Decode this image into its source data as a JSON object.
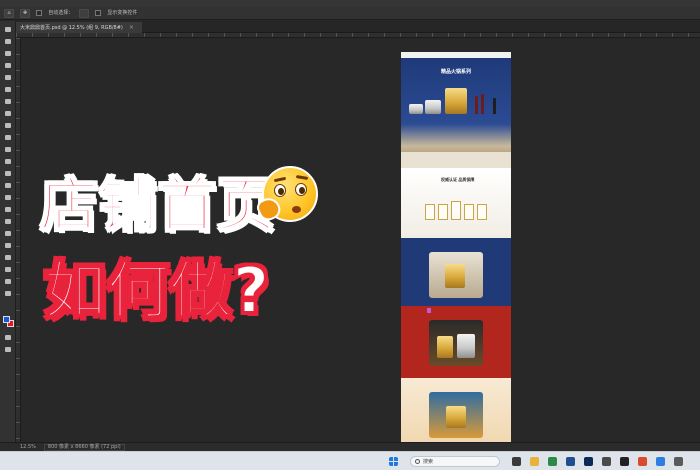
{
  "app": {
    "options_bar": {
      "auto_select_label": "自动选择：",
      "layer_select_value": "",
      "show_transform_label": "显示变换控件"
    },
    "document_tab": {
      "title": "大米鼎鼎首页.psd @ 12.5% (组 9, RGB/8#)",
      "close_glyph": "×"
    },
    "tools": [
      "move-tool",
      "artboard-tool",
      "marquee-tool",
      "lasso-tool",
      "magic-wand-tool",
      "crop-tool",
      "frame-tool",
      "eyedropper-tool",
      "healing-brush-tool",
      "brush-tool",
      "clone-stamp-tool",
      "history-brush-tool",
      "eraser-tool",
      "gradient-tool",
      "blur-tool",
      "dodge-tool",
      "pen-tool",
      "type-tool",
      "path-selection-tool",
      "shape-tool",
      "hand-tool",
      "zoom-tool",
      "more-tools"
    ],
    "colors": {
      "foreground": "#1a56d6",
      "background": "#e0182c"
    },
    "status_bar": {
      "zoom": "12.5%",
      "doc_info": "800 像素 x 8660 像素 (72 ppi)"
    }
  },
  "overlay": {
    "title_line_1": "店铺首页",
    "title_line_2": "如何做?",
    "emoji": "thinking-face-emoji",
    "accent": "#e8233b"
  },
  "artboard": {
    "hero": {
      "title": "精品火锅系列",
      "subtitle": ""
    },
    "section_2": {
      "title": "权威认证 品质保障",
      "subtitle": ""
    },
    "section_3": {
      "title": ""
    },
    "section_4": {
      "title": "",
      "tag": ""
    },
    "section_5": {
      "title": ""
    },
    "section_6": {
      "title": ""
    }
  },
  "taskbar": {
    "search_placeholder": "搜索"
  }
}
